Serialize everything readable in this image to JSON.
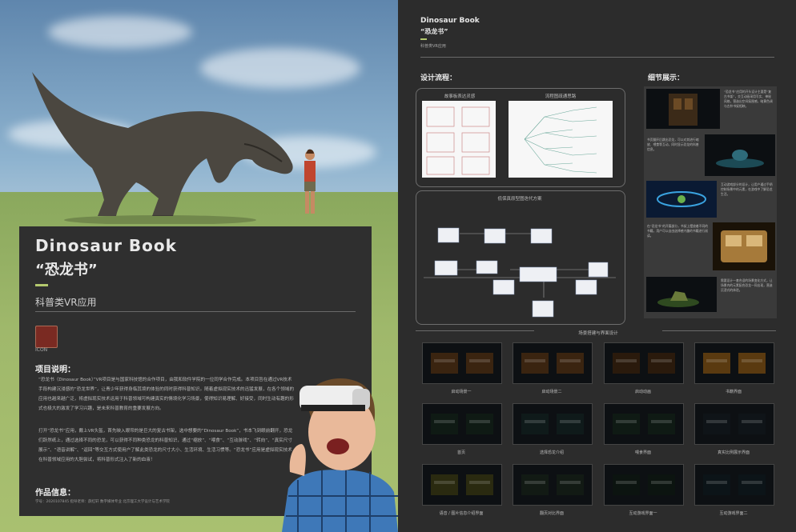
{
  "left_panel": {
    "title_en": "Dinosaur Book",
    "title_cn": "“恐龙书”",
    "subtitle": "科普类VR应用",
    "icon_label": "ICON",
    "project_heading": "项目说明：",
    "project_para_1": "“恐龙书（Dinosaur Book）”VR项目是与国家科技馆的合作项目，由我和软件学院的一位同学合作完成。本项目旨在通过VR技术手段构建沉浸感的“恐龙世界”，让青少年获得身临其境的体验的同时获得科普知识。随着虚拟现实技术的迅猛发展，在各个领域的应用也越来越广泛，将虚拟现实技术运用于科普领域可构建真实的情境化学习场景，使得知识易理解、好接受，同时生动有趣的形式也极大的激发了学习兴趣，是未来科普教育的重要发展方向。",
    "project_para_2": "打开“恐龙书”应用，戴上VR头盔，首先映入眼帘的是巨大的复古书架，选中想要的“Dinosaur Book”，书本飞到眼前翻开，恐龙们跃然纸上，通过选择不同的恐龙，可以获得不同种类恐龙的科普知识，通过“缩放”、“喂食”、“互动游戏”、“转向”、“真实尺寸展示”、“语音讲解”、“返回”等交互方式使用户了解此类恐龙的尺寸大小、生活环境、生活习惯等。“恐龙书”应用是虚拟现实技术在科普领域应用的大胆尝试，将科普形式注入了新的血液！",
    "credits_heading": "作品信息：",
    "credits": "学号：2020107845    指导老师：薛红轩    数字媒体专业    北京理工大学设计与艺术学院"
  },
  "right_panel": {
    "title_en": "Dinosaur Book",
    "title_cn": "“恐龙书”",
    "subtitle": "科普类VR应用",
    "design_heading": "设计流程：",
    "detail_heading": "细节展示：",
    "storyboard_label": "故事板表达灵感",
    "flowchart_label": "流程图疏通思路",
    "prototype_label": "低保真原型图迭代方案",
    "scene_label": "场景搭建与界面设计",
    "detail_texts": [
      "“恐龙书”应用的开头设计主要是“复古书架”，交互动画采用写实、神秘风格，营造出空间氛围感，暗黄色调与古朴书架相映。",
      "书页翻开后跳出恐龙，可以对其进行缩放、喂食等互动，同时显示恐龙的科普信息。",
      "互动游戏部分的设计，让用户通过手柄控制场景中的元素，在游戏中了解恐龙生活。",
      "在“恐龙书”的开篇部分，书架上摆放着不同的书籍，用户可以自由选择感兴趣的书籍进行阅读。",
      "需要设计一套合适的场景变化方式，让场景内的元素配合恐龙一同出现，营造沉浸式的体验。"
    ],
    "thumbnails": [
      "启动场景一",
      "启动场景二",
      "启动动画",
      "书籍界面",
      "首页",
      "选择恐龙介绍",
      "喂食界面",
      "真实比例展示界面",
      "语音 / 图片信息介绍界面",
      "翻页对比界面",
      "互动游戏界面一",
      "互动游戏界面二"
    ]
  }
}
